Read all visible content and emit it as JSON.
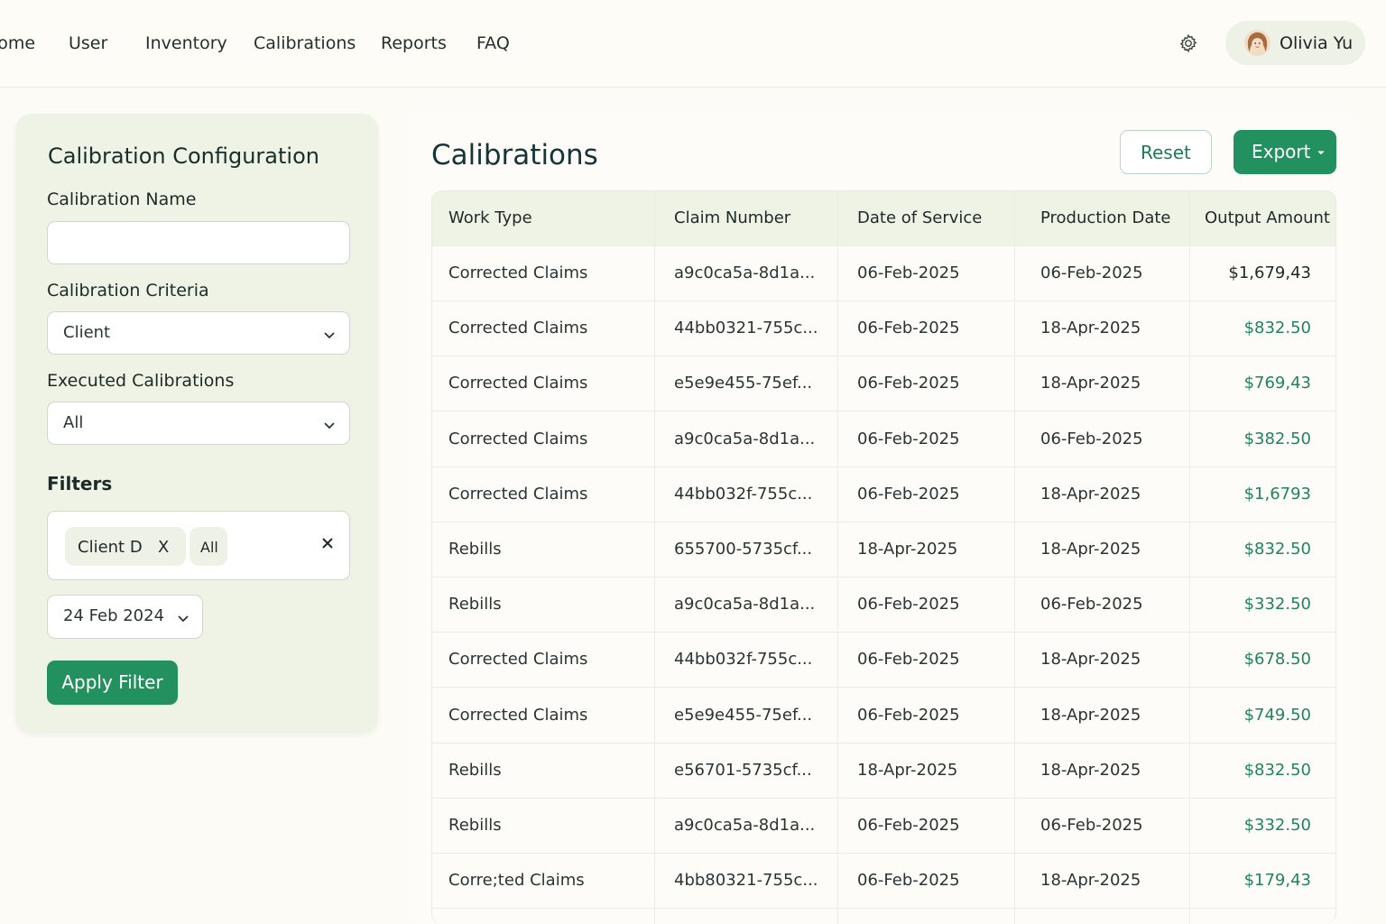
{
  "nav": {
    "items": [
      "lome",
      "User",
      "Inventory",
      "Calibrations",
      "Reports",
      "FAQ"
    ],
    "user_name": "Olivia Yu"
  },
  "config": {
    "title": "Calibration Configuration",
    "name_label": "Calibration Name",
    "name_value": "",
    "criteria_label": "Calibration Criteria",
    "criteria_value": "Client",
    "executed_label": "Executed Calibrations",
    "executed_value": "All",
    "filters_title": "Filters",
    "chips": [
      {
        "label": "Client D",
        "remove": "X"
      },
      {
        "label": "All"
      }
    ],
    "date_value": "24 Feb 2024",
    "apply_label": "Apply Filter"
  },
  "main": {
    "title": "Calibrations",
    "reset_label": "Reset",
    "export_label": "Export"
  },
  "table": {
    "columns": [
      "Work Type",
      "Claim Number",
      "Date of Service",
      "Production Date",
      "Output Amount"
    ],
    "rows": [
      [
        "Corrected Claims",
        "a9c0ca5a-8d1a...",
        "06-Feb-2025",
        "06-Feb-2025",
        "$1,679,43"
      ],
      [
        "Corrected Claims",
        "44bb0321-755c...",
        "06-Feb-2025",
        "18-Apr-2025",
        "$832.50"
      ],
      [
        "Corrected Claims",
        "e5e9e455-75ef...",
        "06-Feb-2025",
        "18-Apr-2025",
        "$769,43"
      ],
      [
        "Corrected Claims",
        "a9c0ca5a-8d1a...",
        "06-Feb-2025",
        "06-Feb-2025",
        "$382.50"
      ],
      [
        "Corrected Claims",
        "44bb032f-755c...",
        "06-Feb-2025",
        "18-Apr-2025",
        "$1,6793"
      ],
      [
        "Rebills",
        "655700-5735cf...",
        "18-Apr-2025",
        "18-Apr-2025",
        "$832.50"
      ],
      [
        "Rebills",
        "a9c0ca5a-8d1a...",
        "06-Feb-2025",
        "06-Feb-2025",
        "$332.50"
      ],
      [
        "Corrected Claims",
        "44bb032f-755c...",
        "06-Feb-2025",
        "18-Apr-2025",
        "$678.50"
      ],
      [
        "Corrected Claims",
        "e5e9e455-75ef...",
        "06-Feb-2025",
        "18-Apr-2025",
        "$749.50"
      ],
      [
        "Rebills",
        "e56701-5735cf...",
        "18-Apr-2025",
        "18-Apr-2025",
        "$832.50"
      ],
      [
        "Rebills",
        "a9c0ca5a-8d1a...",
        "06-Feb-2025",
        "06-Feb-2025",
        "$332.50"
      ],
      [
        "Corre;ted Claims",
        "4bb80321-755c...",
        "06-Feb-2025",
        "18-Apr-2025",
        "$179,43"
      ]
    ]
  },
  "colors": {
    "accent": "#23905f",
    "amount_text": "#21845a",
    "panel_bg": "#eef3e6",
    "page_bg": "#fcfbf6"
  },
  "icons": {
    "settings": "gear-icon",
    "avatar": "user-avatar",
    "dropdown": "chevron-down-icon",
    "remove": "close-icon"
  }
}
